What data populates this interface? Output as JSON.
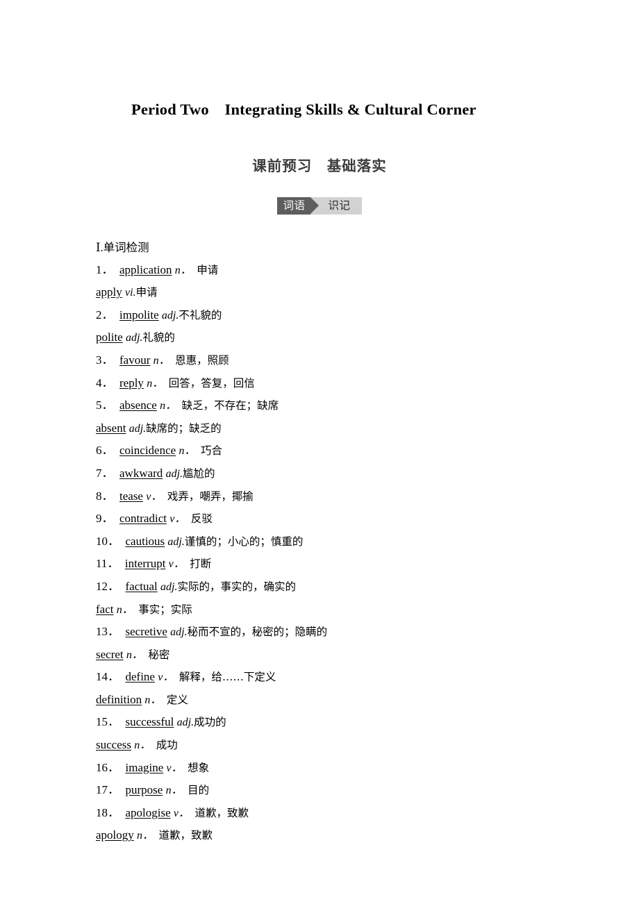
{
  "title": "Period Two　Integrating Skills & Cultural Corner",
  "section_heading": "课前预习　基础落实",
  "badge": {
    "left_label": "词语",
    "right_label": "识记",
    "left_bg": "#5e5e5e",
    "right_bg": "#d2d2d2",
    "left_text_color": "#ffffff",
    "right_text_color": "#2b2b2b"
  },
  "list_label": "Ⅰ.单词检测",
  "entries": [
    {
      "number": "1．",
      "word": "application",
      "pos": "n．",
      "gloss": "　申请"
    },
    {
      "number": "",
      "word": "apply",
      "pos": "vi.",
      "gloss": "申请",
      "derived": true
    },
    {
      "number": "2．",
      "word": "impolite",
      "pos": "adj.",
      "gloss": "不礼貌的"
    },
    {
      "number": "",
      "word": "polite",
      "pos": "adj.",
      "gloss": "礼貌的",
      "derived": true
    },
    {
      "number": "3．",
      "word": "favour",
      "pos": "n．",
      "gloss": "　恩惠，照顾"
    },
    {
      "number": "4．",
      "word": "reply",
      "pos": "n．",
      "gloss": "　回答，答复，回信"
    },
    {
      "number": "5．",
      "word": "absence",
      "pos": "n．",
      "gloss": "　缺乏，不存在；缺席"
    },
    {
      "number": "",
      "word": "absent",
      "pos": "adj.",
      "gloss": "缺席的；缺乏的",
      "derived": true
    },
    {
      "number": "6．",
      "word": "coincidence",
      "pos": "n．",
      "gloss": "　巧合"
    },
    {
      "number": "7．",
      "word": "awkward",
      "pos": "adj.",
      "gloss": "尴尬的"
    },
    {
      "number": "8．",
      "word": "tease",
      "pos": "v．",
      "gloss": "　戏弄，嘲弄，揶揄"
    },
    {
      "number": "9．",
      "word": "contradict",
      "pos": "v．",
      "gloss": "　反驳"
    },
    {
      "number": "10．",
      "word": "cautious",
      "pos": "adj.",
      "gloss": "谨慎的；小心的；慎重的"
    },
    {
      "number": "11．",
      "word": "interrupt",
      "pos": "v．",
      "gloss": "　打断"
    },
    {
      "number": "12．",
      "word": "factual",
      "pos": "adj.",
      "gloss": "实际的，事实的，确实的"
    },
    {
      "number": "",
      "word": "fact",
      "pos": "n．",
      "gloss": "　事实；实际",
      "derived": true
    },
    {
      "number": "13．",
      "word": "secretive",
      "pos": "adj.",
      "gloss": "秘而不宣的，秘密的；隐瞒的"
    },
    {
      "number": "",
      "word": "secret",
      "pos": "n．",
      "gloss": "　秘密",
      "derived": true
    },
    {
      "number": "14．",
      "word": "define",
      "pos": "v．",
      "gloss": "　解释，给……下定义"
    },
    {
      "number": "",
      "word": "definition",
      "pos": "n．",
      "gloss": "　定义",
      "derived": true
    },
    {
      "number": "15．",
      "word": "successful",
      "pos": "adj.",
      "gloss": "成功的"
    },
    {
      "number": "",
      "word": "success",
      "pos": "n．",
      "gloss": "　成功",
      "derived": true
    },
    {
      "number": "16．",
      "word": "imagine",
      "pos": "v．",
      "gloss": "　想象"
    },
    {
      "number": "17．",
      "word": "purpose",
      "pos": "n．",
      "gloss": "　目的"
    },
    {
      "number": "18．",
      "word": "apologise",
      "pos": "v．",
      "gloss": "　道歉，致歉"
    },
    {
      "number": "",
      "word": "apology",
      "pos": "n．",
      "gloss": "　道歉，致歉",
      "derived": true
    }
  ]
}
